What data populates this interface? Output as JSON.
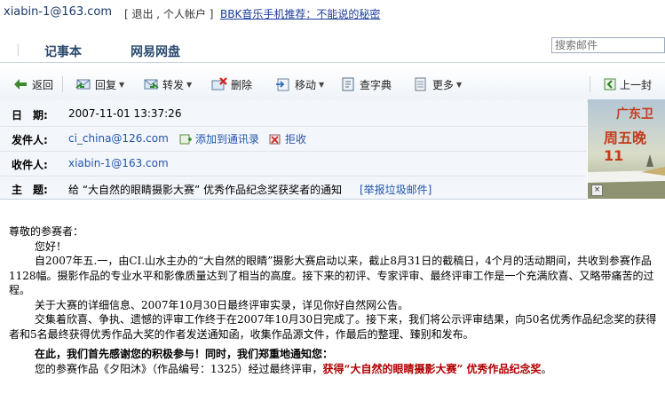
{
  "topbar": {
    "user": "xiabin-1@163.com",
    "links": "[ 退出 , 个人帐户 ]",
    "promo": "BBK音乐手机推荐：不能说的秘密"
  },
  "nav": {
    "items": [
      "记事本",
      "网易网盘"
    ],
    "search_placeholder": "搜索邮件"
  },
  "toolbar": {
    "back": "返回",
    "reply": "回复",
    "forward": "转发",
    "delete": "删除",
    "move": "移动",
    "dict": "查字典",
    "more": "更多",
    "prev": "上一封"
  },
  "header": {
    "date_label": "日　期:",
    "date": "2007-11-01 13:37:26",
    "from_label": "发件人:",
    "from": "ci_china@126.com",
    "add_contact": "添加到通讯录",
    "reject": "拒收",
    "to_label": "收件人:",
    "to": "xiabin-1@163.com",
    "subject_label": "主　题:",
    "subject": "给 “大自然的眼睛摄影大赛” 优秀作品纪念奖获奖者的通知",
    "report_spam": "[举报垃圾邮件]"
  },
  "ad": {
    "line1": "广东卫",
    "line2": "周五晚11"
  },
  "body": {
    "greeting": "尊敬的参赛者：",
    "hello": "您好！",
    "p1": "自2007年五.一，由CI.山水主办的“大自然的眼睛”摄影大赛启动以来，截止8月31日的截稿日，4个月的活动期间，共收到参赛作品1128幅。摄影作品的专业水平和影像质量达到了相当的高度。接下来的初评、专家评审、最终评审工作是一个充满欣喜、又略带痛苦的过程。",
    "p2": "关于大赛的详细信息、2007年10月30日最终评审实录，详见你好自然网公告。",
    "p3": "交集着欣喜、争执、遗憾的评审工作终于在2007年10月30日完成了。接下来，我们将公示评审结果，向50名优秀作品纪念奖的获得者和5名最终获得优秀作品大奖的作者发送通知函，收集作品源文件，作最后的整理、臻别和发布。",
    "p4": "在此，我们首先感谢您的积极参与！同时，我们郑重地通知您：",
    "p5_pre": "您的参赛作品《夕阳沐》（作品编号：1325）经过最终评审，",
    "p5_red": "获得“大自然的眼睛摄影大赛” 优秀作品纪念奖",
    "p5_end": "。"
  }
}
